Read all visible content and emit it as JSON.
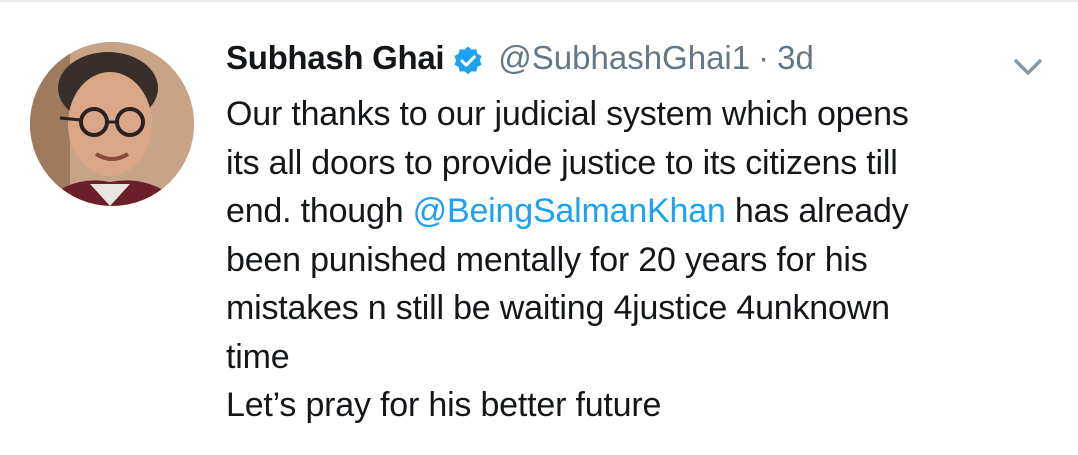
{
  "tweet": {
    "author": {
      "display_name": "Subhash Ghai",
      "handle": "@SubhashGhai1",
      "verified": true
    },
    "separator": "·",
    "time_ago": "3d",
    "text_lines": {
      "l1": "Our thanks to our judicial system which opens",
      "l2": "its all doors to provide justice to its citizens till",
      "l3_before": "end. though ",
      "l3_mention": "@BeingSalmanKhan",
      "l3_after": " has already",
      "l4": "been punished mentally for 20 years for his",
      "l5": "mistakes n still be waiting 4justice 4unknown",
      "l6": "time",
      "l7": "Let’s pray for his better future"
    },
    "icons": {
      "verified": "verified-badge-icon",
      "menu": "chevron-down-icon"
    },
    "colors": {
      "text": "#14171a",
      "secondary": "#657786",
      "mention": "#1da1f2",
      "verified": "#1da1f2"
    }
  }
}
